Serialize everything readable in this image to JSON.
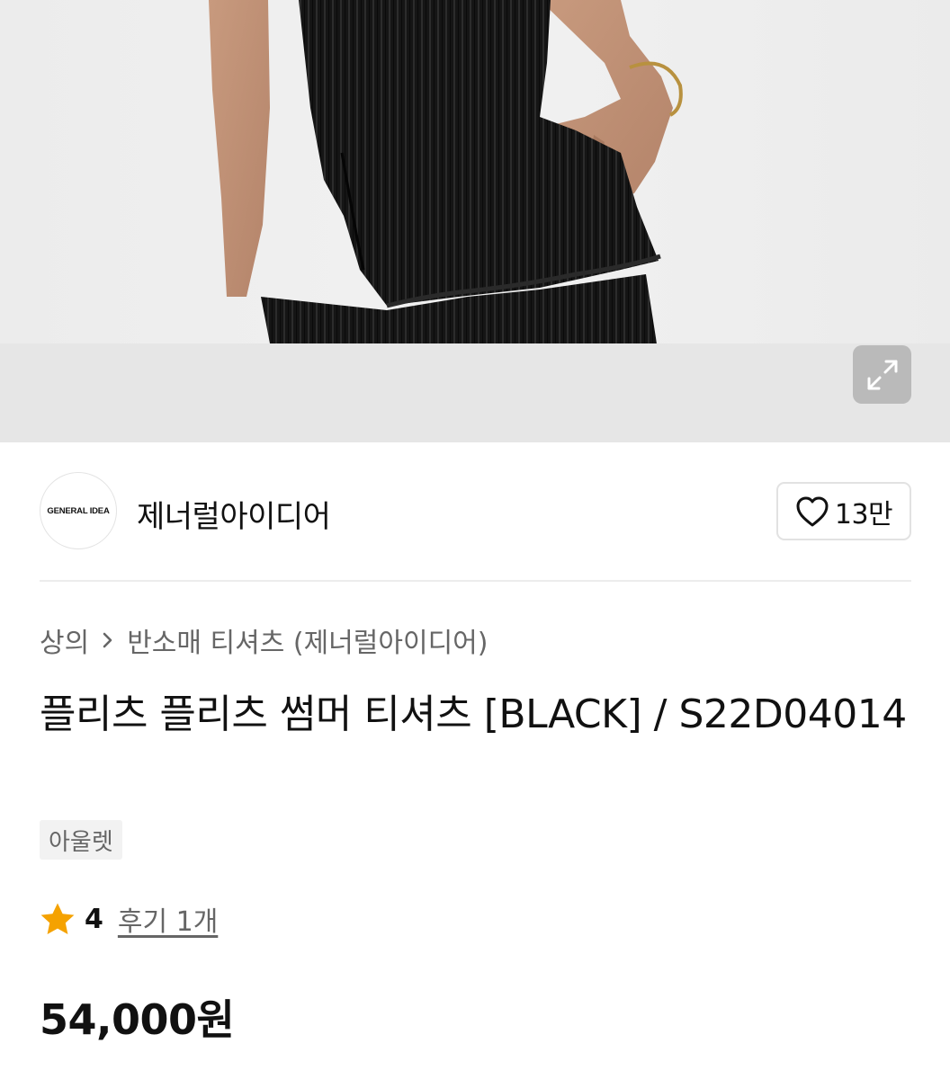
{
  "brand": {
    "logo_text": "GENERAL IDEA",
    "name": "제너럴아이디어"
  },
  "like": {
    "count": "13만",
    "icon": "heart-outline-icon"
  },
  "gallery": {
    "expand_icon": "expand-arrows-icon"
  },
  "breadcrumb": {
    "category": "상의",
    "separator_icon": "chevron-right-icon",
    "subcategory": "반소매 티셔츠 (제너럴아이디어)"
  },
  "product": {
    "title": "플리츠 플리츠 썸머 티셔츠 [BLACK] / S22D04014",
    "tag": "아울렛",
    "price": "54,000원"
  },
  "rating": {
    "star_icon": "star-icon",
    "star_color": "#F5A200",
    "score": "4",
    "review_link": "후기 1개"
  }
}
